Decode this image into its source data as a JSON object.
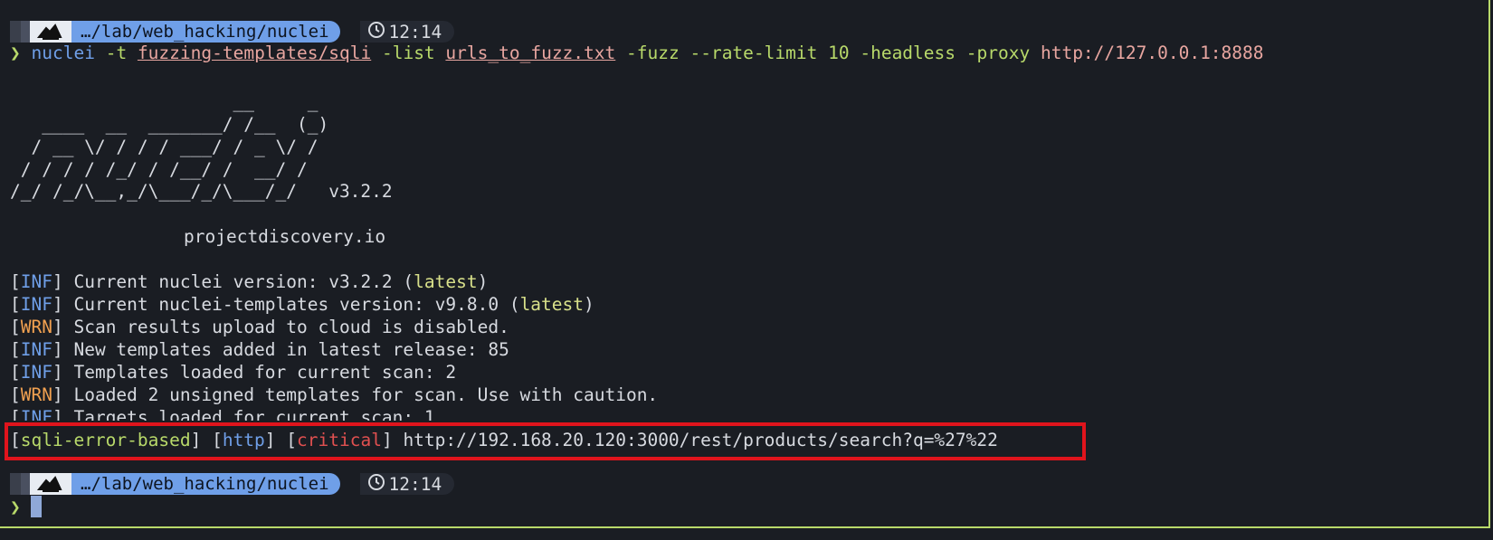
{
  "prompt": {
    "path": "…/lab/web_hacking/nuclei",
    "time": "12:14",
    "chevron": "❯"
  },
  "command": {
    "bin": "nuclei",
    "flag_t": "-t",
    "templates": "fuzzing-templates/sqli",
    "flag_list": "-list",
    "list_file": "urls_to_fuzz.txt",
    "flag_fuzz": "-fuzz",
    "flag_rate": "--rate-limit",
    "rate_value": "10",
    "flag_headless": "-headless",
    "flag_proxy": "-proxy",
    "proxy_url": "http://127.0.0.1:8888"
  },
  "banner": {
    "lines": [
      "                     __     _",
      "   ____  __  _______/ /__  (_)",
      "  / __ \\/ / / / ___/ / _ \\/ /",
      " / / / / /_/ / /__/ /  __/ /",
      "/_/ /_/\\__,_/\\___/_/\\___/_/   v3.2.2"
    ],
    "site": "projectdiscovery.io"
  },
  "logs": [
    {
      "level": "INF",
      "text": " Current nuclei version: v3.2.2 (",
      "tag": "latest",
      "tail": ")"
    },
    {
      "level": "INF",
      "text": " Current nuclei-templates version: v9.8.0 (",
      "tag": "latest",
      "tail": ")"
    },
    {
      "level": "WRN",
      "text": " Scan results upload to cloud is disabled.",
      "tag": "",
      "tail": ""
    },
    {
      "level": "INF",
      "text": " New templates added in latest release: 85",
      "tag": "",
      "tail": ""
    },
    {
      "level": "INF",
      "text": " Templates loaded for current scan: 2",
      "tag": "",
      "tail": ""
    },
    {
      "level": "WRN",
      "text": " Loaded 2 unsigned templates for scan. Use with caution.",
      "tag": "",
      "tail": ""
    },
    {
      "level": "INF",
      "text": " Targets loaded for current scan: 1",
      "tag": "",
      "tail": ""
    }
  ],
  "finding": {
    "template": "sqli-error-based",
    "protocol": "http",
    "severity": "critical",
    "url": "http://192.168.20.120:3000/rest/products/search?q=%27%22"
  },
  "colors": {
    "background": "#1a1d23",
    "accent_blue": "#6f9fe8",
    "accent_green": "#b8d96a",
    "warn_orange": "#f0a050",
    "critical_red": "#e05050",
    "highlight_box": "#e0141c"
  },
  "icons": [
    "os-logo-icon",
    "clock-icon",
    "prompt-chevron-icon"
  ]
}
